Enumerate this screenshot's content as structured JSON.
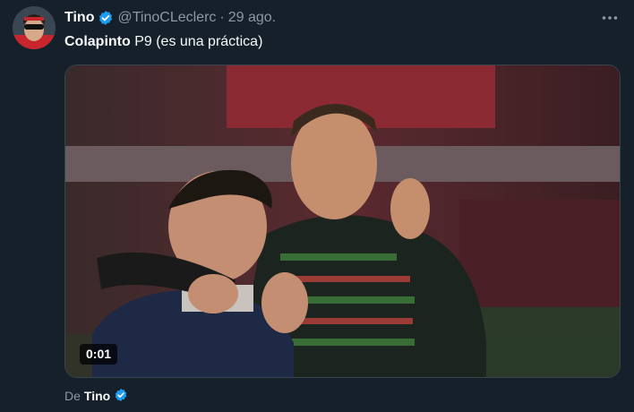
{
  "tweet": {
    "author_name": "Tino",
    "author_handle": "@TinoCLeclerc",
    "separator": "·",
    "time": "29 ago.",
    "text_bold": "Colapinto",
    "text_rest": " P9 (es una práctica)",
    "video_timestamp": "0:01",
    "from_label": "De",
    "from_name": "Tino"
  },
  "icons": {
    "verified": "verified-badge-icon",
    "more": "more-horizontal-icon"
  },
  "colors": {
    "background": "#15202b",
    "verified_blue": "#1d9bf0",
    "secondary_text": "#8b98a5"
  }
}
